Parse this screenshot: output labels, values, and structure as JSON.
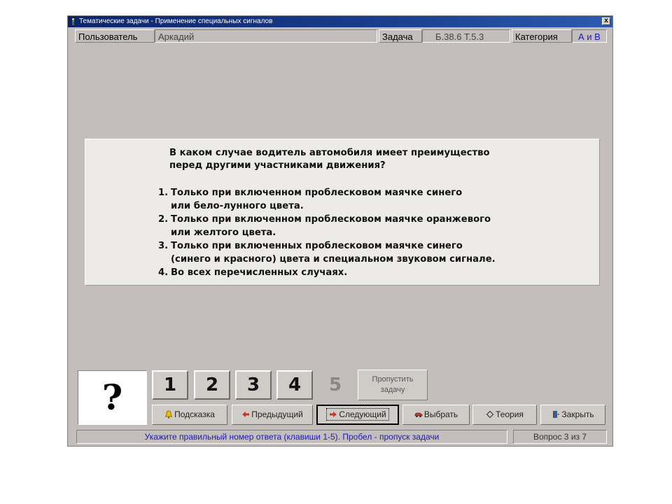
{
  "window": {
    "title": "Тематические задачи - Применение специальных сигналов",
    "close_label": "x"
  },
  "infobar": {
    "user_label": "Пользователь",
    "user_value": "Аркадий",
    "task_label": "Задача",
    "task_value": "Б.38.6  Т.5.3",
    "category_label": "Категория",
    "category_value": "А и В"
  },
  "question": {
    "text": "В каком случае водитель автомобиля имеет преимущество\nперед другими участниками движения?",
    "answers": [
      {
        "num": "1.",
        "text": "Только при включенном проблесковом маячке синего\nили бело-лунного цвета."
      },
      {
        "num": "2.",
        "text": "Только при включенном проблесковом маячке оранжевого\nили желтого цвета."
      },
      {
        "num": "3.",
        "text": "Только при включенных проблесковом маячке синего\n(синего и красного) цвета и специальном звуковом сигнале."
      },
      {
        "num": "4.",
        "text": "Во всех перечисленных случаях."
      }
    ]
  },
  "answer_box": {
    "mark": "?"
  },
  "number_buttons": [
    "1",
    "2",
    "3",
    "4",
    "5"
  ],
  "skip_button": {
    "label": "Пропустить\nзадачу"
  },
  "actions": {
    "hint": "Подсказка",
    "prev": "Предыдущий",
    "next": "Следующий",
    "select": "Выбрать",
    "theory": "Теория",
    "close": "Закрыть"
  },
  "status": {
    "message": "Укажите правильный номер ответа (клавиши 1-5). Пробел - пропуск задачи",
    "counter": "Вопрос 3 из 7"
  },
  "colors": {
    "title_bar": "#0a246a",
    "window_bg": "#c3bebb",
    "panel_bg": "#ecebe8",
    "status_text": "#1a1ab8"
  },
  "icons": {
    "hint": "bell-icon",
    "prev": "arrow-left-icon",
    "next": "arrow-right-icon",
    "select": "car-icon",
    "theory": "diamond-icon",
    "close": "door-exit-icon"
  }
}
